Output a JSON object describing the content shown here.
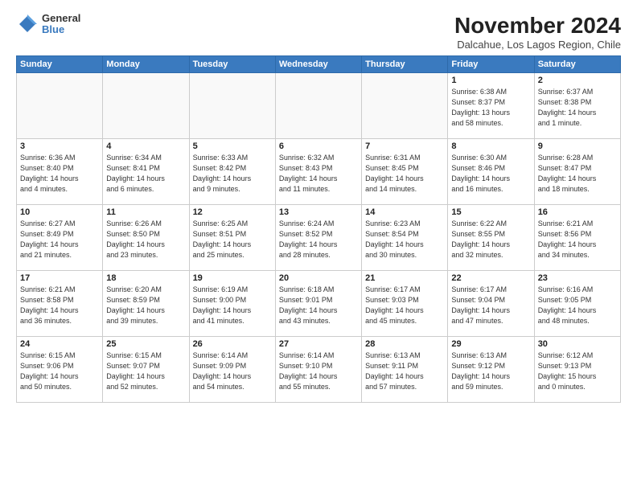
{
  "header": {
    "logo_general": "General",
    "logo_blue": "Blue",
    "month_title": "November 2024",
    "subtitle": "Dalcahue, Los Lagos Region, Chile"
  },
  "weekdays": [
    "Sunday",
    "Monday",
    "Tuesday",
    "Wednesday",
    "Thursday",
    "Friday",
    "Saturday"
  ],
  "weeks": [
    [
      {
        "day": "",
        "info": ""
      },
      {
        "day": "",
        "info": ""
      },
      {
        "day": "",
        "info": ""
      },
      {
        "day": "",
        "info": ""
      },
      {
        "day": "",
        "info": ""
      },
      {
        "day": "1",
        "info": "Sunrise: 6:38 AM\nSunset: 8:37 PM\nDaylight: 13 hours\nand 58 minutes."
      },
      {
        "day": "2",
        "info": "Sunrise: 6:37 AM\nSunset: 8:38 PM\nDaylight: 14 hours\nand 1 minute."
      }
    ],
    [
      {
        "day": "3",
        "info": "Sunrise: 6:36 AM\nSunset: 8:40 PM\nDaylight: 14 hours\nand 4 minutes."
      },
      {
        "day": "4",
        "info": "Sunrise: 6:34 AM\nSunset: 8:41 PM\nDaylight: 14 hours\nand 6 minutes."
      },
      {
        "day": "5",
        "info": "Sunrise: 6:33 AM\nSunset: 8:42 PM\nDaylight: 14 hours\nand 9 minutes."
      },
      {
        "day": "6",
        "info": "Sunrise: 6:32 AM\nSunset: 8:43 PM\nDaylight: 14 hours\nand 11 minutes."
      },
      {
        "day": "7",
        "info": "Sunrise: 6:31 AM\nSunset: 8:45 PM\nDaylight: 14 hours\nand 14 minutes."
      },
      {
        "day": "8",
        "info": "Sunrise: 6:30 AM\nSunset: 8:46 PM\nDaylight: 14 hours\nand 16 minutes."
      },
      {
        "day": "9",
        "info": "Sunrise: 6:28 AM\nSunset: 8:47 PM\nDaylight: 14 hours\nand 18 minutes."
      }
    ],
    [
      {
        "day": "10",
        "info": "Sunrise: 6:27 AM\nSunset: 8:49 PM\nDaylight: 14 hours\nand 21 minutes."
      },
      {
        "day": "11",
        "info": "Sunrise: 6:26 AM\nSunset: 8:50 PM\nDaylight: 14 hours\nand 23 minutes."
      },
      {
        "day": "12",
        "info": "Sunrise: 6:25 AM\nSunset: 8:51 PM\nDaylight: 14 hours\nand 25 minutes."
      },
      {
        "day": "13",
        "info": "Sunrise: 6:24 AM\nSunset: 8:52 PM\nDaylight: 14 hours\nand 28 minutes."
      },
      {
        "day": "14",
        "info": "Sunrise: 6:23 AM\nSunset: 8:54 PM\nDaylight: 14 hours\nand 30 minutes."
      },
      {
        "day": "15",
        "info": "Sunrise: 6:22 AM\nSunset: 8:55 PM\nDaylight: 14 hours\nand 32 minutes."
      },
      {
        "day": "16",
        "info": "Sunrise: 6:21 AM\nSunset: 8:56 PM\nDaylight: 14 hours\nand 34 minutes."
      }
    ],
    [
      {
        "day": "17",
        "info": "Sunrise: 6:21 AM\nSunset: 8:58 PM\nDaylight: 14 hours\nand 36 minutes."
      },
      {
        "day": "18",
        "info": "Sunrise: 6:20 AM\nSunset: 8:59 PM\nDaylight: 14 hours\nand 39 minutes."
      },
      {
        "day": "19",
        "info": "Sunrise: 6:19 AM\nSunset: 9:00 PM\nDaylight: 14 hours\nand 41 minutes."
      },
      {
        "day": "20",
        "info": "Sunrise: 6:18 AM\nSunset: 9:01 PM\nDaylight: 14 hours\nand 43 minutes."
      },
      {
        "day": "21",
        "info": "Sunrise: 6:17 AM\nSunset: 9:03 PM\nDaylight: 14 hours\nand 45 minutes."
      },
      {
        "day": "22",
        "info": "Sunrise: 6:17 AM\nSunset: 9:04 PM\nDaylight: 14 hours\nand 47 minutes."
      },
      {
        "day": "23",
        "info": "Sunrise: 6:16 AM\nSunset: 9:05 PM\nDaylight: 14 hours\nand 48 minutes."
      }
    ],
    [
      {
        "day": "24",
        "info": "Sunrise: 6:15 AM\nSunset: 9:06 PM\nDaylight: 14 hours\nand 50 minutes."
      },
      {
        "day": "25",
        "info": "Sunrise: 6:15 AM\nSunset: 9:07 PM\nDaylight: 14 hours\nand 52 minutes."
      },
      {
        "day": "26",
        "info": "Sunrise: 6:14 AM\nSunset: 9:09 PM\nDaylight: 14 hours\nand 54 minutes."
      },
      {
        "day": "27",
        "info": "Sunrise: 6:14 AM\nSunset: 9:10 PM\nDaylight: 14 hours\nand 55 minutes."
      },
      {
        "day": "28",
        "info": "Sunrise: 6:13 AM\nSunset: 9:11 PM\nDaylight: 14 hours\nand 57 minutes."
      },
      {
        "day": "29",
        "info": "Sunrise: 6:13 AM\nSunset: 9:12 PM\nDaylight: 14 hours\nand 59 minutes."
      },
      {
        "day": "30",
        "info": "Sunrise: 6:12 AM\nSunset: 9:13 PM\nDaylight: 15 hours\nand 0 minutes."
      }
    ]
  ]
}
